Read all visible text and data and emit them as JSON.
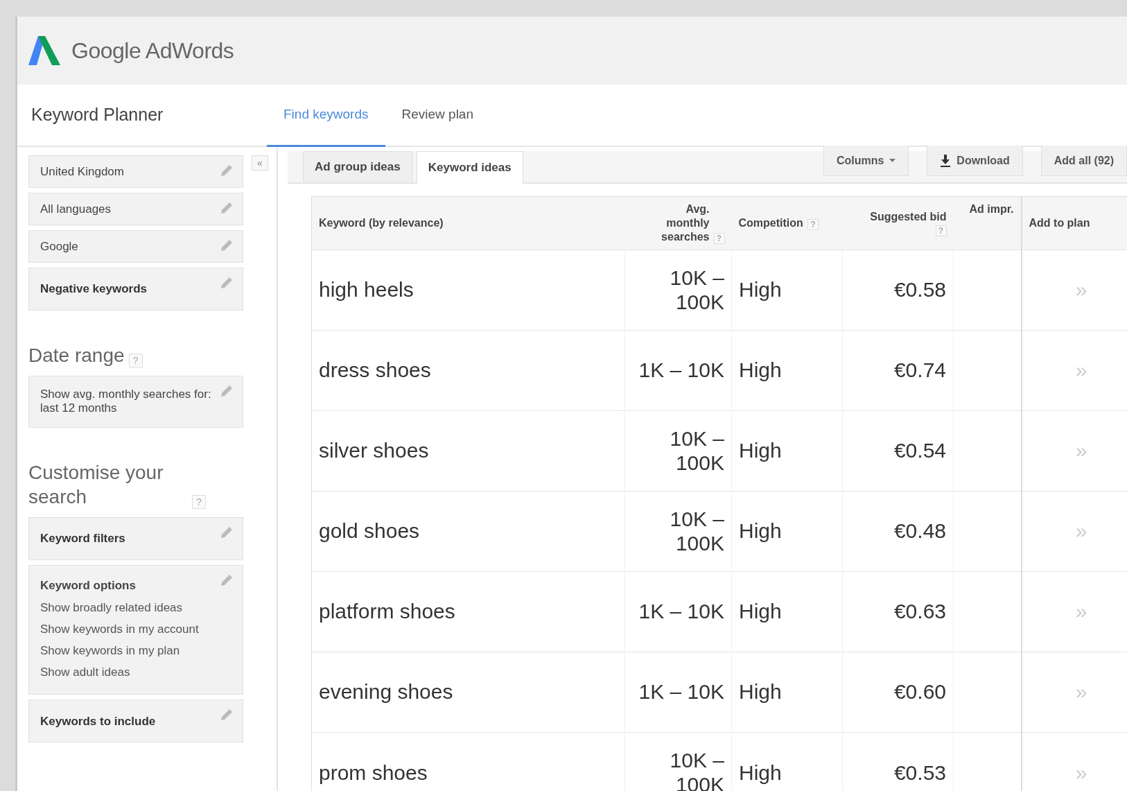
{
  "header": {
    "brand": "Google AdWords"
  },
  "page": {
    "title": "Keyword Planner"
  },
  "tabs": [
    {
      "label": "Find keywords",
      "selected": true
    },
    {
      "label": "Review plan",
      "selected": false
    }
  ],
  "sidebar": {
    "collapse": "«",
    "targeting": [
      {
        "label": "United Kingdom",
        "kind": "value"
      },
      {
        "label": "All languages",
        "kind": "value"
      },
      {
        "label": "Google",
        "kind": "value"
      },
      {
        "label": "Negative keywords",
        "kind": "heading"
      }
    ],
    "date_range": {
      "title": "Date range",
      "help": "?",
      "text": "Show avg. monthly searches for: last 12 months"
    },
    "customise": {
      "title": "Customise your search",
      "help": "?",
      "items": [
        {
          "title": "Keyword filters"
        },
        {
          "title": "Keyword options",
          "lines": [
            "Show broadly related ideas",
            "Show keywords in my account",
            "Show keywords in my plan",
            "Show adult ideas"
          ]
        },
        {
          "title": "Keywords to include"
        }
      ]
    }
  },
  "subtabs": [
    {
      "label": "Ad group ideas",
      "selected": false
    },
    {
      "label": "Keyword ideas",
      "selected": true
    }
  ],
  "toolbar": [
    {
      "label": "Columns",
      "kind": "dropdown"
    },
    {
      "label": "Download",
      "kind": "download"
    },
    {
      "label": "Add all (92)",
      "kind": "plain"
    }
  ],
  "table": {
    "columns": [
      {
        "label": "Keyword (by relevance)"
      },
      {
        "label": "Avg. monthly searches",
        "help": "?"
      },
      {
        "label": "Competition",
        "help": "?"
      },
      {
        "label": "Suggested bid",
        "help": "?"
      },
      {
        "label": "Ad impr."
      },
      {
        "label": "Add to plan"
      }
    ],
    "rows": [
      {
        "keyword": "high heels",
        "searches": "10K – 100K",
        "competition": "High",
        "bid": "€0.58",
        "add": "»"
      },
      {
        "keyword": "dress shoes",
        "searches": "1K – 10K",
        "competition": "High",
        "bid": "€0.74",
        "add": "»"
      },
      {
        "keyword": "silver shoes",
        "searches": "10K – 100K",
        "competition": "High",
        "bid": "€0.54",
        "add": "»"
      },
      {
        "keyword": "gold shoes",
        "searches": "10K – 100K",
        "competition": "High",
        "bid": "€0.48",
        "add": "»"
      },
      {
        "keyword": "platform shoes",
        "searches": "1K – 10K",
        "competition": "High",
        "bid": "€0.63",
        "add": "»"
      },
      {
        "keyword": "evening shoes",
        "searches": "1K – 10K",
        "competition": "High",
        "bid": "€0.60",
        "add": "»"
      },
      {
        "keyword": "prom shoes",
        "searches": "10K – 100K",
        "competition": "High",
        "bid": "€0.53",
        "add": "»"
      }
    ]
  }
}
